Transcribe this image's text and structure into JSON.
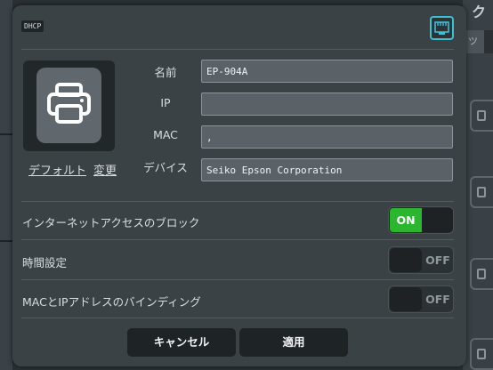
{
  "dialog": {
    "badge": "DHCP",
    "header_icon": "network-icon"
  },
  "client": {
    "avatar_icon": "printer-icon",
    "default_link": "デフォルト",
    "change_link": "変更"
  },
  "fields": {
    "name_label": "名前",
    "name_value": "EP-904A",
    "ip_label": "IP",
    "ip_value": "",
    "mac_label": "MAC",
    "mac_value": ",",
    "device_label": "デバイス",
    "device_value": "Seiko Epson Corporation"
  },
  "settings": [
    {
      "label": "インターネットアクセスのブロック",
      "state_on": "ON",
      "state_off": "OFF",
      "enabled": true
    },
    {
      "label": "時間設定",
      "state_on": "ON",
      "state_off": "OFF",
      "enabled": false
    },
    {
      "label": "MACとIPアドレスのバインディング",
      "state_on": "ON",
      "state_off": "OFF",
      "enabled": false
    }
  ],
  "buttons": {
    "cancel": "キャンセル",
    "apply": "適用"
  },
  "colors": {
    "accent": "#3ec0d2",
    "toggle_on": "#2cb52f",
    "dialog_bg": "#3b4246"
  }
}
